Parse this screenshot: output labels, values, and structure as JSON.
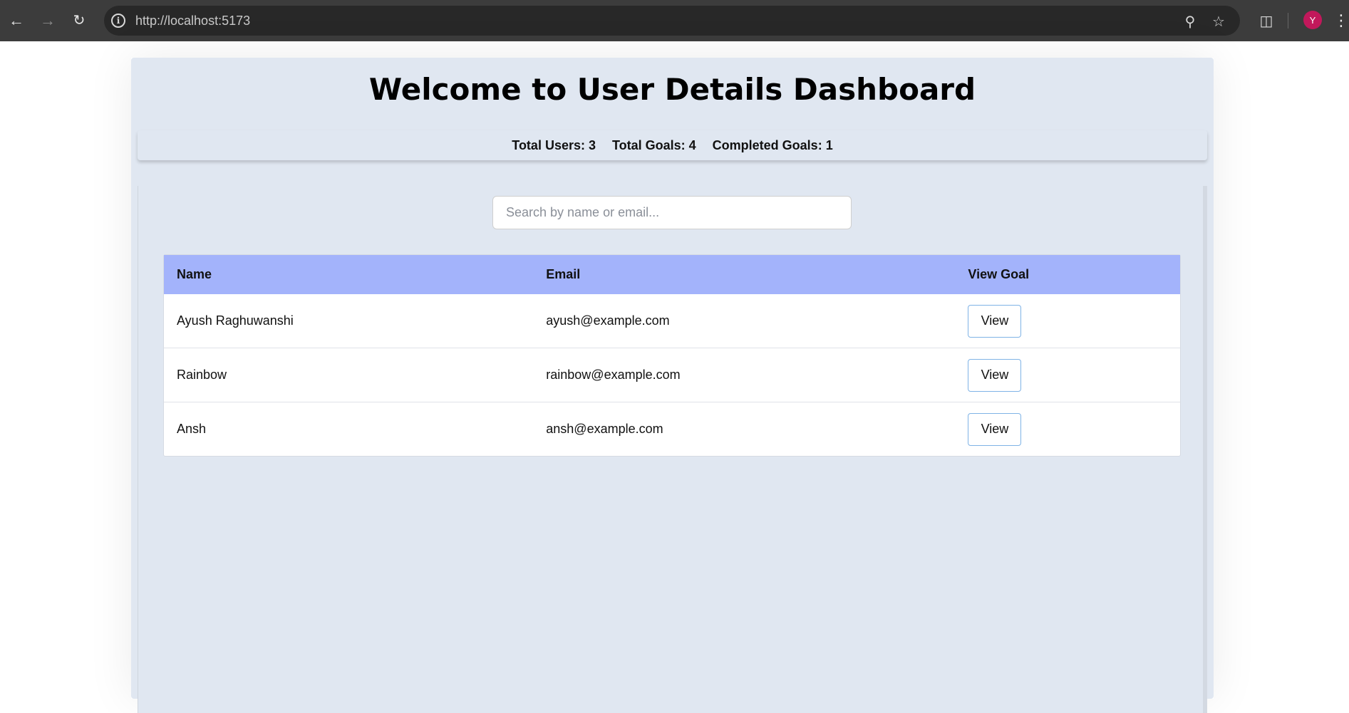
{
  "browser": {
    "url": "http://localhost:5173",
    "avatar_letter": "Y"
  },
  "header": {
    "title": "Welcome to User Details Dashboard"
  },
  "stats": {
    "total_users": "Total Users: 3",
    "total_goals": "Total Goals: 4",
    "completed_goals": "Completed Goals: 1"
  },
  "search": {
    "placeholder": "Search by name or email...",
    "value": ""
  },
  "table": {
    "columns": [
      "Name",
      "Email",
      "View Goal"
    ],
    "rows": [
      {
        "name": "Ayush Raghuwanshi",
        "email": "ayush@example.com",
        "action": "View"
      },
      {
        "name": "Rainbow",
        "email": "rainbow@example.com",
        "action": "View"
      },
      {
        "name": "Ansh",
        "email": "ansh@example.com",
        "action": "View"
      }
    ]
  },
  "colors": {
    "page_bg": "#e0e7f1",
    "table_header_bg": "#a3b3fb",
    "button_border": "#7fb3e6",
    "avatar_bg": "#c2185b"
  }
}
